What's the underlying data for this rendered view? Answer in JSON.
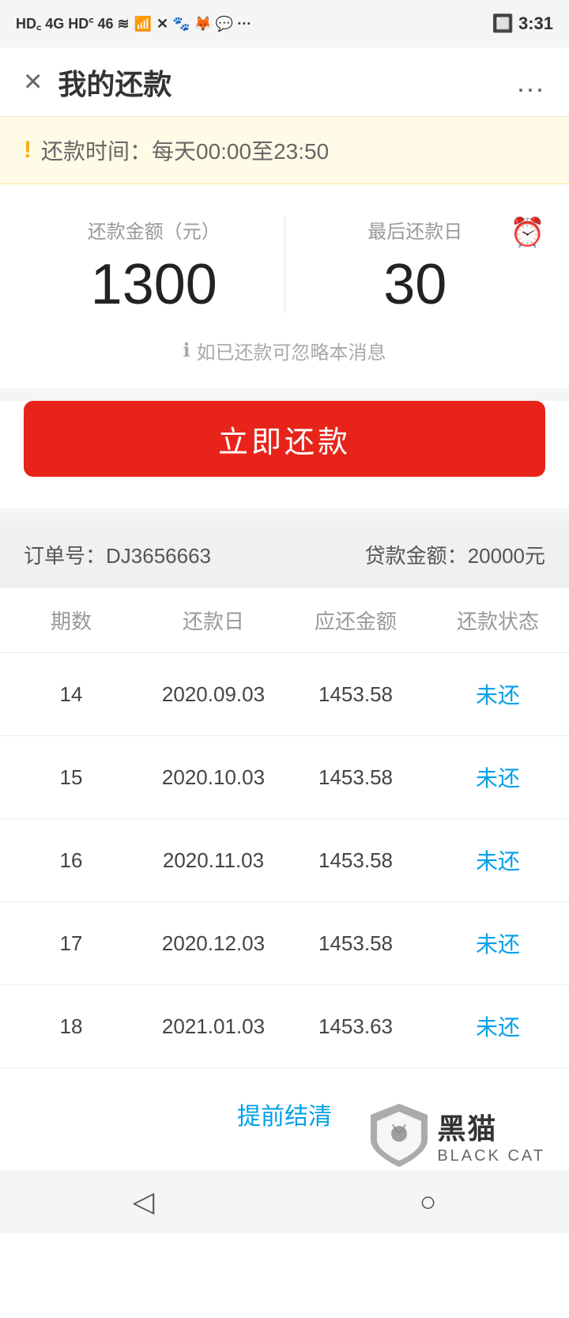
{
  "statusBar": {
    "left": "HD 4G HD 4G 46 ≋ ✕",
    "right": "3:31"
  },
  "header": {
    "closeLabel": "×",
    "title": "我的还款",
    "moreLabel": "..."
  },
  "notice": {
    "icon": "!",
    "text": "还款时间：每天00:00至23:50"
  },
  "summary": {
    "amountLabel": "还款金额（元）",
    "amountValue": "1300",
    "dueDateLabel": "最后还款日",
    "dueDateValue": "30",
    "hint": "如已还款可忽略本消息"
  },
  "payButton": {
    "label": "立即还款"
  },
  "order": {
    "orderLabel": "订单号：",
    "orderNo": "DJ3656663",
    "loanLabel": "贷款金额：",
    "loanAmount": "20000元"
  },
  "table": {
    "headers": [
      "期数",
      "还款日",
      "应还金额",
      "还款状态"
    ],
    "rows": [
      {
        "period": "14",
        "date": "2020.09.03",
        "amount": "1453.58",
        "status": "未还"
      },
      {
        "period": "15",
        "date": "2020.10.03",
        "amount": "1453.58",
        "status": "未还"
      },
      {
        "period": "16",
        "date": "2020.11.03",
        "amount": "1453.58",
        "status": "未还"
      },
      {
        "period": "17",
        "date": "2020.12.03",
        "amount": "1453.58",
        "status": "未还"
      },
      {
        "period": "18",
        "date": "2021.01.03",
        "amount": "1453.63",
        "status": "未还"
      }
    ]
  },
  "earlySettlement": {
    "label": "提前结清"
  },
  "logo": {
    "heima": "黑猫",
    "blackcat": "BLACK CAT"
  },
  "nav": {
    "back": "◁",
    "home": "○"
  }
}
